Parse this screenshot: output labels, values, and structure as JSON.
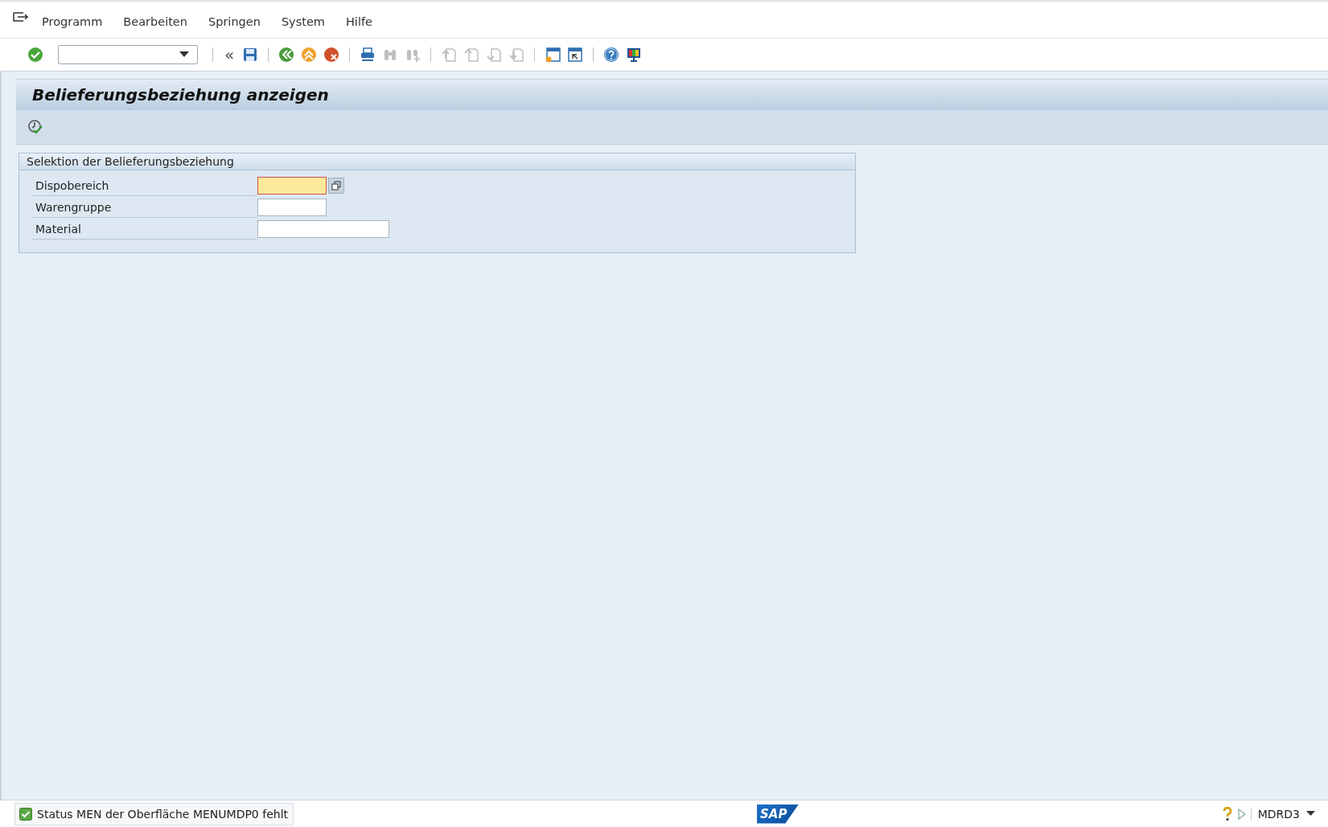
{
  "menu_bar": {
    "items": [
      "Programm",
      "Bearbeiten",
      "Springen",
      "System",
      "Hilfe"
    ]
  },
  "toolbar": {
    "buttons": [
      {
        "kind": "enter",
        "disabled": false
      },
      {
        "kind": "sep"
      },
      {
        "kind": "collapse",
        "label": "«",
        "disabled": false
      },
      {
        "kind": "save",
        "disabled": false
      },
      {
        "kind": "sep"
      },
      {
        "kind": "back",
        "disabled": false
      },
      {
        "kind": "exit",
        "disabled": false
      },
      {
        "kind": "cancel",
        "disabled": false
      },
      {
        "kind": "sep"
      },
      {
        "kind": "print",
        "disabled": false
      },
      {
        "kind": "find",
        "disabled": true
      },
      {
        "kind": "findnext",
        "disabled": true
      },
      {
        "kind": "sep"
      },
      {
        "kind": "first",
        "disabled": true
      },
      {
        "kind": "prev",
        "disabled": true
      },
      {
        "kind": "next",
        "disabled": true
      },
      {
        "kind": "last",
        "disabled": true
      },
      {
        "kind": "sep"
      },
      {
        "kind": "newsession",
        "disabled": false
      },
      {
        "kind": "shortcut",
        "disabled": false
      },
      {
        "kind": "sep"
      },
      {
        "kind": "help",
        "disabled": false
      },
      {
        "kind": "layout",
        "disabled": false
      }
    ]
  },
  "title": "Belieferungsbeziehung anzeigen",
  "app_toolbar": {
    "buttons": [
      {
        "kind": "execute"
      }
    ]
  },
  "group": {
    "title": "Selektion der Belieferungsbeziehung",
    "fields": [
      {
        "label": "Dispobereich",
        "kind": "short",
        "focused": true,
        "value_help": true
      },
      {
        "label": "Warengruppe",
        "kind": "short",
        "focused": false,
        "value_help": false
      },
      {
        "label": "Material",
        "kind": "long",
        "focused": false,
        "value_help": false
      }
    ]
  },
  "status_bar": {
    "message": {
      "text": "Status MEN der Oberfläche MENUMDP0 fehlt",
      "kind": "success"
    },
    "logo": "SAP",
    "system": "MDRD3"
  }
}
